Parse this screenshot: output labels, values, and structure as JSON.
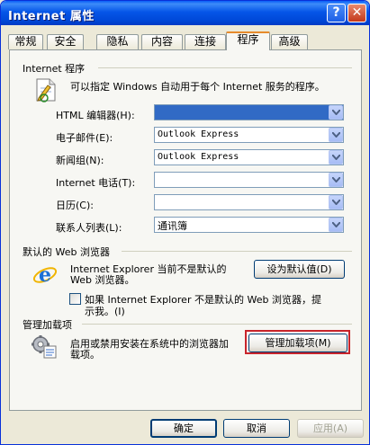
{
  "window": {
    "title": "Internet 属性",
    "help_label": "?",
    "close_label": "✕"
  },
  "tabs": [
    {
      "label": "常规",
      "active": false
    },
    {
      "label": "安全",
      "active": false
    },
    {
      "label": "隐私",
      "active": false
    },
    {
      "label": "内容",
      "active": false
    },
    {
      "label": "连接",
      "active": false
    },
    {
      "label": "程序",
      "active": true
    },
    {
      "label": "高级",
      "active": false
    }
  ],
  "programs": {
    "group_title": "Internet 程序",
    "description": "可以指定 Windows 自动用于每个 Internet 服务的程序。",
    "rows": [
      {
        "label": "HTML 编辑器(H):",
        "value": "",
        "selected": true
      },
      {
        "label": "电子邮件(E):",
        "value": "Outlook Express",
        "selected": false
      },
      {
        "label": "新闻组(N):",
        "value": "Outlook Express",
        "selected": false
      },
      {
        "label": "Internet 电话(T):",
        "value": "",
        "selected": false
      },
      {
        "label": "日历(C):",
        "value": "",
        "selected": false
      },
      {
        "label": "联系人列表(L):",
        "value": "通讯簿",
        "selected": false
      }
    ]
  },
  "default_browser": {
    "group_title": "默认的 Web 浏览器",
    "status_line1": "Internet Explorer 当前不是默认的",
    "status_line2": "Web 浏览器。",
    "set_default_label": "设为默认值(D)",
    "check_line1": "如果 Internet Explorer 不是默认的 Web 浏览器，提",
    "check_line2": "示我。(I)",
    "checked": false
  },
  "addons": {
    "group_title": "管理加载项",
    "desc_line1": "启用或禁用安装在系统中的浏览器加",
    "desc_line2": "载项。",
    "manage_label": "管理加载项(M)"
  },
  "footer": {
    "ok_label": "确定",
    "cancel_label": "取消",
    "apply_label": "应用(A)"
  },
  "colors": {
    "titlebar": "#0054e3",
    "selection": "#316ac5",
    "highlight_box": "#c8242b",
    "active_tab_accent": "#e68b2c"
  }
}
